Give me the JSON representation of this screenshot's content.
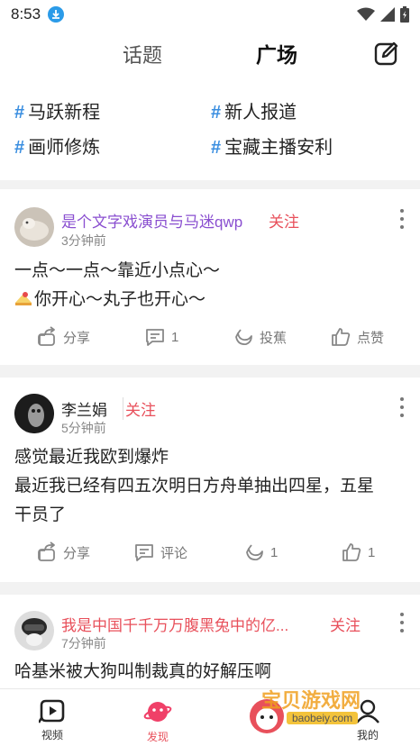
{
  "status": {
    "time": "8:53"
  },
  "tabs": {
    "topic": "话题",
    "square": "广场"
  },
  "topics": [
    {
      "label": "马跃新程"
    },
    {
      "label": "新人报道"
    },
    {
      "label": "画师修炼"
    },
    {
      "label": "宝藏主播安利"
    }
  ],
  "posts": [
    {
      "username": "是个文字戏演员与马迷qwp",
      "follow": "关注",
      "time": "3分钟前",
      "lines": [
        "一点～一点～靠近小点心～",
        "你开心～丸子也开心～"
      ],
      "share": "分享",
      "comment": "1",
      "feed": "投蕉",
      "like": "点赞"
    },
    {
      "username": "李兰娟",
      "follow": "关注",
      "time": "5分钟前",
      "lines": [
        "感觉最近我欧到爆炸",
        "最近我已经有四五次明日方舟单抽出四星，五星",
        "干员了"
      ],
      "share": "分享",
      "comment": "评论",
      "feed": "1",
      "like": "1"
    },
    {
      "username": "我是中国千千万万腹黑兔中的亿...",
      "follow": "关注",
      "time": "7分钟前",
      "lines": [
        "哈基米被大狗叫制裁真的好解压啊"
      ]
    }
  ],
  "bottom_nav": {
    "video": "视频",
    "discover": "发现",
    "mine": "我的"
  },
  "watermark": {
    "title": "宝贝游戏网",
    "url": "baobeiy.com"
  },
  "colors": {
    "accent": "#e8505b",
    "hashtag": "#3a8ee0",
    "purple_name": "#8a4fd0"
  }
}
